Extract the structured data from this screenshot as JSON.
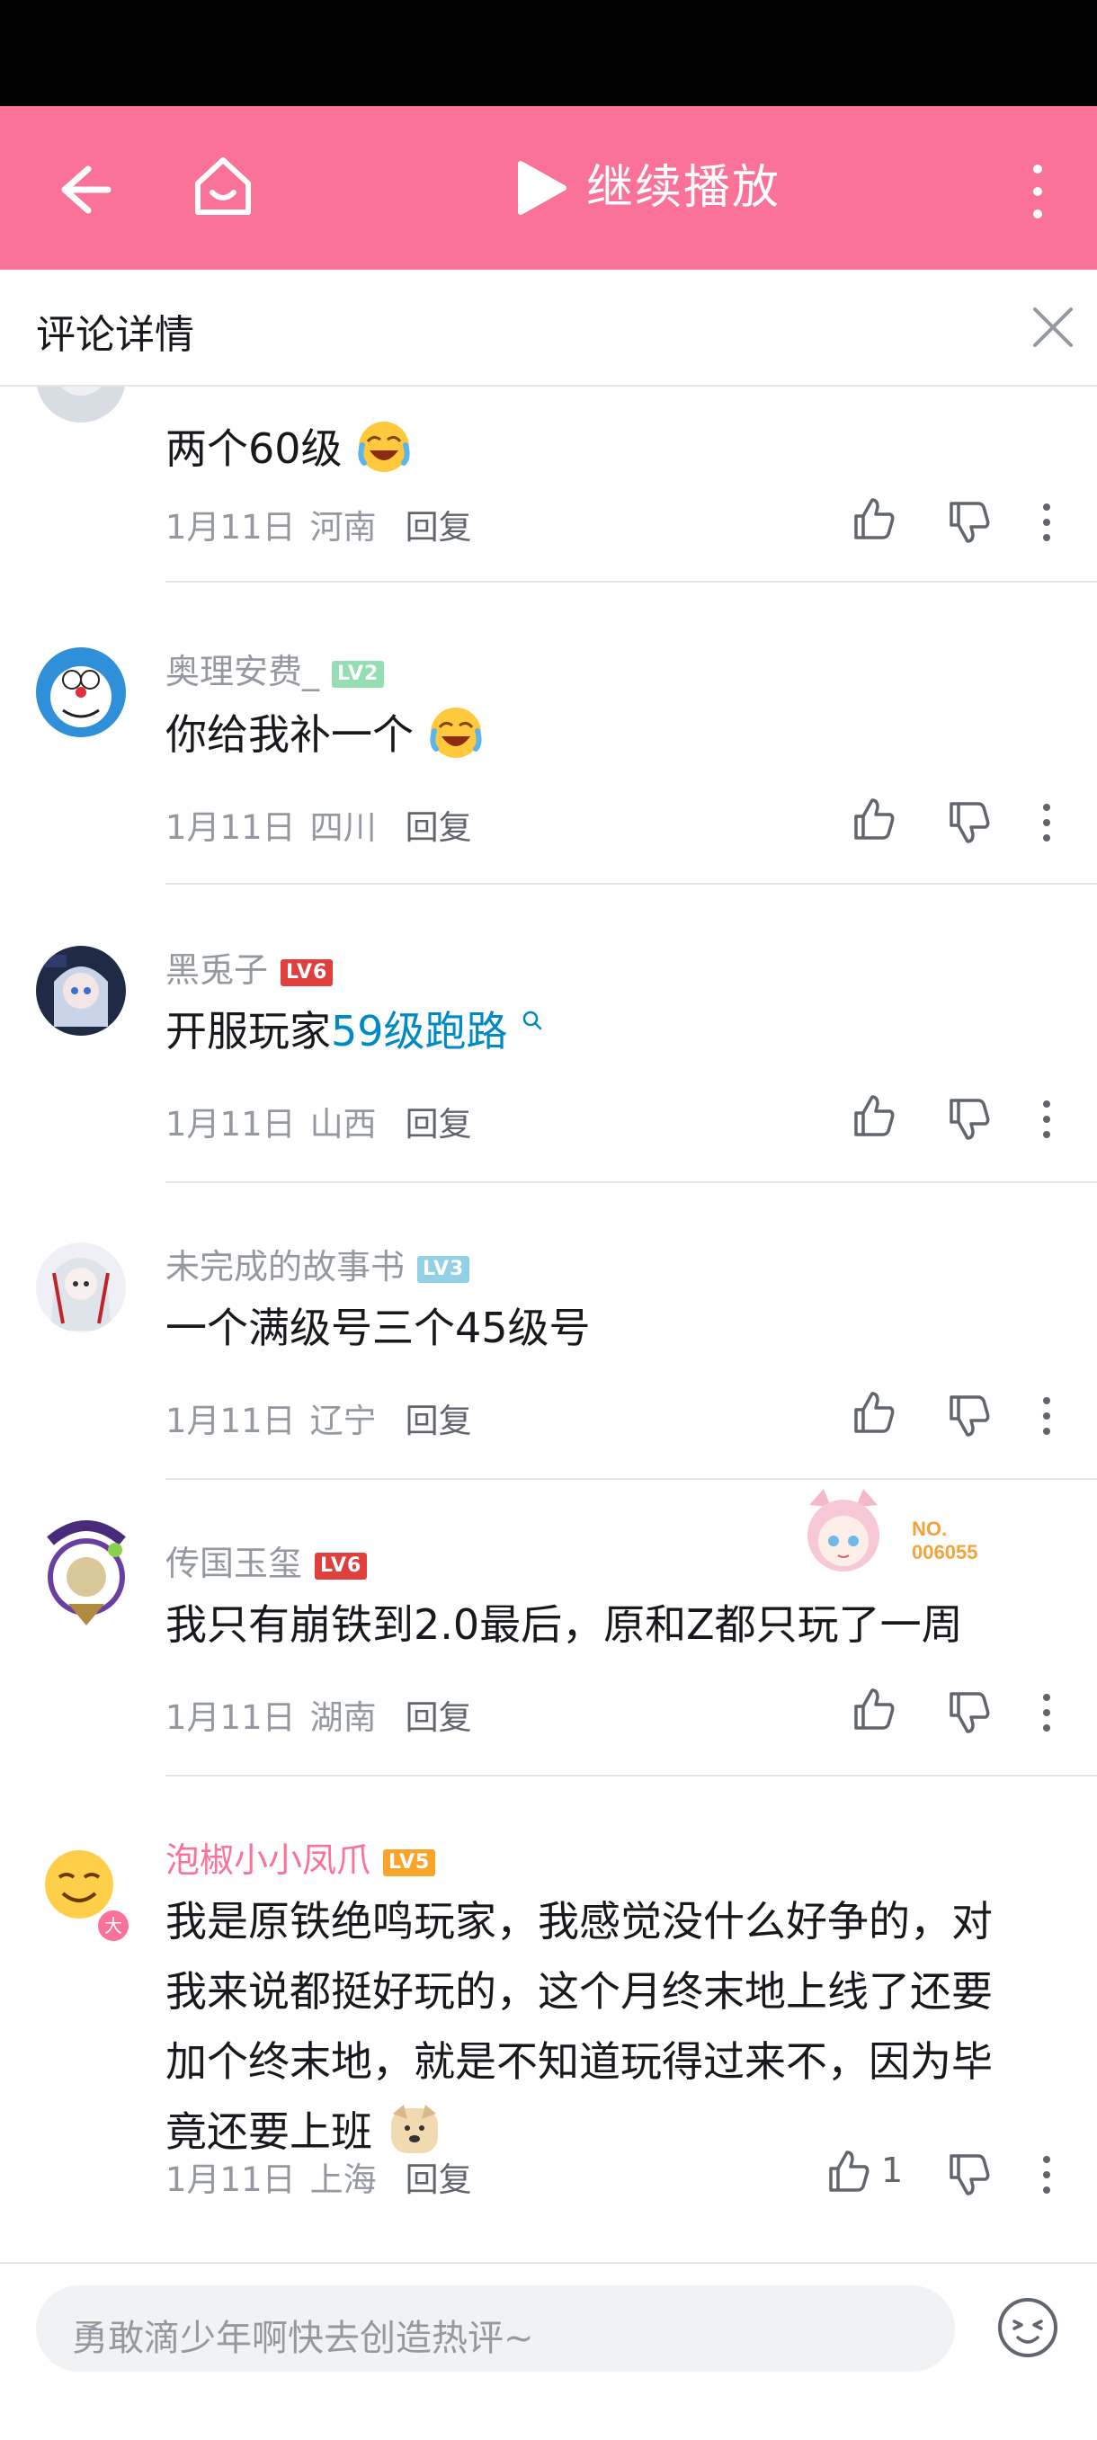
{
  "top_bar": {
    "continue_label": "继续播放",
    "bg_color": "#fb7299"
  },
  "panel": {
    "title": "评论详情"
  },
  "comments": [
    {
      "username": "",
      "text": "两个60级",
      "emoji": "laugh-cry-emoji",
      "date": "1月11日",
      "location": "河南",
      "reply_label": "回复"
    },
    {
      "username": "奥理安费_",
      "level": "LV2",
      "level_color": "#95ddb2",
      "text": "你给我补一个",
      "emoji": "laugh-cry-emoji",
      "date": "1月11日",
      "location": "四川",
      "reply_label": "回复"
    },
    {
      "username": "黑兎子",
      "level": "LV6",
      "level_color": "#e0403d",
      "text_prefix": "开服玩家",
      "text_link": "59级跑路",
      "date": "1月11日",
      "location": "山西",
      "reply_label": "回复"
    },
    {
      "username": "未完成的故事书",
      "level": "LV3",
      "level_color": "#92d1e5",
      "text": "一个满级号三个45级号",
      "date": "1月11日",
      "location": "辽宁",
      "reply_label": "回复"
    },
    {
      "username": "传国玉玺",
      "level": "LV6",
      "level_color": "#e0403d",
      "text": "我只有崩铁到2.0最后，原和Z都只玩了一周",
      "date": "1月11日",
      "location": "湖南",
      "reply_label": "回复",
      "badge_text_1": "NO.",
      "badge_text_2": "006055"
    },
    {
      "username": "泡椒小小凤爪",
      "username_color": "#fb7299",
      "level": "LV5",
      "level_color": "#f9a52b",
      "text": "我是原铁绝鸣玩家，我感觉没什么好争的，对我来说都挺好玩的，这个月终末地上线了还要加个终末地，就是不知道玩得过来不，因为毕竟还要上班",
      "emoji": "dog-emoji",
      "date": "1月11日",
      "location": "上海",
      "reply_label": "回复",
      "like_count": "1",
      "avatar_badge": "大"
    }
  ],
  "bottom": {
    "placeholder": "勇敢滴少年啊快去创造热评~"
  }
}
